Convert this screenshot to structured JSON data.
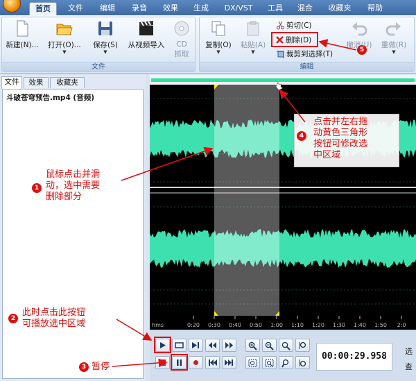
{
  "menu": {
    "tabs": [
      "首页",
      "文件",
      "编辑",
      "录音",
      "效果",
      "生成",
      "DX/VST",
      "工具",
      "混合",
      "收藏夹",
      "帮助"
    ],
    "active": "首页"
  },
  "ribbon": {
    "file_group": {
      "title": "文件",
      "new": "新建(N)...",
      "open": "打开(O)...",
      "save": "保存(S)",
      "from_video": "从视频导入",
      "cd_line1": "CD",
      "cd_line2": "抓取"
    },
    "edit_group": {
      "title": "编辑",
      "copy": "复制(O)",
      "paste": "粘贴(A)",
      "cut": "剪切(C)",
      "delete": "删除(D)",
      "crop": "裁剪到选择(T)",
      "undo": "撤消(U)",
      "redo": "重做(R)"
    }
  },
  "left_panel": {
    "tabs": [
      "文件",
      "效果",
      "收藏夹"
    ],
    "active_tab": "文件",
    "file_name": "斗破苍穹预告.mp4 (音频)"
  },
  "timeline": {
    "unit": "hms",
    "ticks": [
      "0:20",
      "0:30",
      "0:40",
      "0:50",
      "1:00",
      "1:10",
      "1:20",
      "1:30",
      "1:40",
      "1:50",
      "2:0"
    ]
  },
  "transport": {
    "time": "00:00:29.958",
    "side_text_1": "选",
    "side_text_2": "查"
  },
  "annotations": {
    "a1": {
      "num": "1",
      "line1": "鼠标点击并滑",
      "line2": "动，选中需要",
      "line3": "删除部分"
    },
    "a2": {
      "num": "2",
      "line1": "此时点击此按钮",
      "line2": "可播放选中区域"
    },
    "a3": {
      "num": "3",
      "text": "暂停"
    },
    "a4": {
      "num": "4",
      "line1": "点击并左右拖",
      "line2": "动黄色三角形",
      "line3": "按钮可修改选",
      "line4": "中区域"
    },
    "a5": {
      "num": "5"
    }
  },
  "colors": {
    "accent_red": "#e01010",
    "wave": "#3ee0b0",
    "selection": "#9fe8d4",
    "handle": "#ffe600"
  }
}
